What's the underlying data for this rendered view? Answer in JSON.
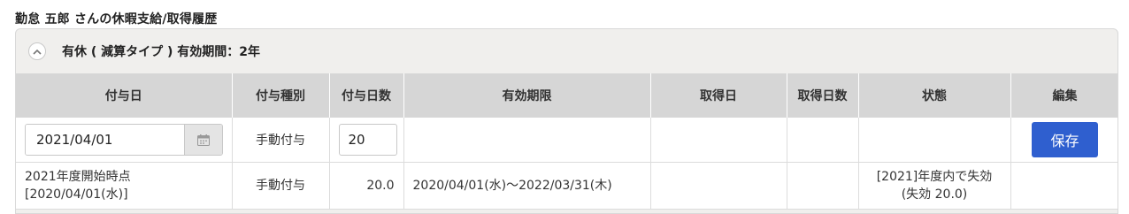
{
  "page": {
    "title": "勤怠 五郎 さんの休暇支給/取得履歴"
  },
  "panel": {
    "heading": "有休 ( 減算タイプ ) 有効期間：2年",
    "collapse_icon": "chevron-up-icon"
  },
  "table": {
    "columns": [
      "付与日",
      "付与種別",
      "付与日数",
      "有効期限",
      "取得日",
      "取得日数",
      "状態",
      "編集"
    ],
    "edit_row": {
      "grant_date": "2021/04/01",
      "calendar_icon": "calendar-icon",
      "grant_type": "手動付与",
      "grant_days": "20",
      "save_label": "保存"
    },
    "rows": [
      {
        "grant_date_line1": "2021年度開始時点",
        "grant_date_line2": "[2020/04/01(水)]",
        "grant_type": "手動付与",
        "grant_days": "20.0",
        "valid_period": "2020/04/01(水)～2022/03/31(木)",
        "taken_date": "",
        "taken_days": "",
        "status_line1": "[2021]年度内で失効",
        "status_line2": "(失効 20.0)"
      }
    ]
  },
  "colors": {
    "save_button": "#2f5fcf",
    "header_bg": "#d6d6d6",
    "panel_bg": "#f0efed"
  }
}
